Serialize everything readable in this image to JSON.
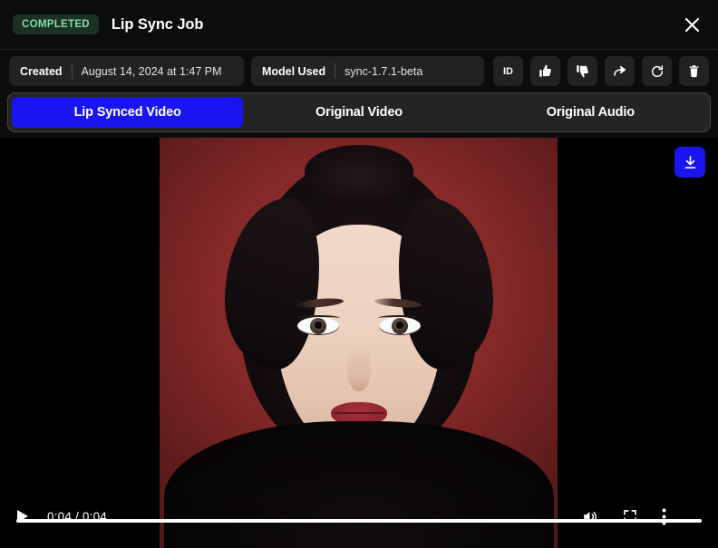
{
  "header": {
    "status_badge": "COMPLETED",
    "title": "Lip Sync Job",
    "close_icon": "close-icon"
  },
  "meta": {
    "created_label": "Created",
    "created_value": "August 14, 2024 at 1:47 PM",
    "model_label": "Model Used",
    "model_value": "sync-1.7.1-beta",
    "actions": [
      {
        "name": "id-button",
        "label": "ID"
      },
      {
        "name": "thumbs-up-button",
        "label": ""
      },
      {
        "name": "thumbs-down-button",
        "label": ""
      },
      {
        "name": "share-button",
        "label": ""
      },
      {
        "name": "retry-button",
        "label": ""
      },
      {
        "name": "delete-button",
        "label": ""
      }
    ]
  },
  "tabs": {
    "active_index": 0,
    "items": [
      {
        "label": "Lip Synced Video"
      },
      {
        "label": "Original Video"
      },
      {
        "label": "Original Audio"
      }
    ]
  },
  "player": {
    "time_display": "0:04 / 0:04",
    "progress_percent": 100,
    "play_icon": "play-icon",
    "volume_icon": "volume-icon",
    "fullscreen_icon": "fullscreen-icon",
    "more-options_icon": "kebab-menu-icon",
    "download_icon": "download-icon"
  },
  "colors": {
    "accent_blue": "#1a15f0",
    "badge_bg": "#1d3024",
    "badge_text": "#7fe0a5",
    "panel_bg": "#0c0c0c",
    "chip_bg": "#222222"
  }
}
